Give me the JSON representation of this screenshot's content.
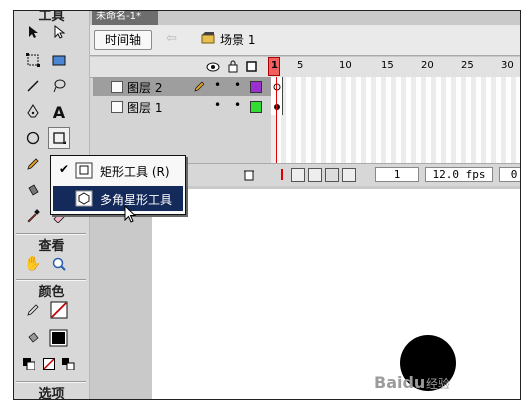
{
  "window": {
    "title": "未命名-1*"
  },
  "toolbox": {
    "section_top": "工具",
    "section_view": "查看",
    "section_colors": "颜色",
    "section_options": "选项"
  },
  "topbar": {
    "timeline_button": "时间轴",
    "scene_label": "场景 1"
  },
  "timeline": {
    "frame_numbers": [
      "1",
      "5",
      "10",
      "15",
      "20",
      "25",
      "30"
    ],
    "layers": [
      {
        "name": "图层 2",
        "selected": true,
        "color": "#9b30d0"
      },
      {
        "name": "图层 1",
        "selected": false,
        "color": "#33dd33"
      }
    ],
    "current_frame": "1",
    "frame_rate": "12.0 fps",
    "elapsed": "0"
  },
  "popup": {
    "items": [
      {
        "label": "矩形工具 (R)",
        "checked": true
      },
      {
        "label": "多角星形工具",
        "checked": false,
        "highlighted": true
      }
    ]
  },
  "colors": {
    "stroke": "#c00000",
    "fill": "#000000",
    "popup_highlight": "#142a5a",
    "playhead": "#e00000"
  },
  "watermark": {
    "main": "Baidu",
    "suffix": "经验"
  }
}
